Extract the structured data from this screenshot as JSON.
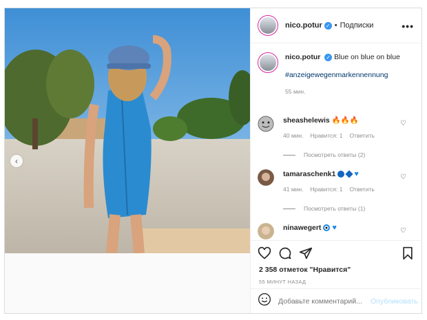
{
  "post": {
    "username": "nico.potur",
    "verified_mark": "✓",
    "separator": "•",
    "follow_label": "Подписки",
    "more_label": "•••",
    "carousel_prev": "‹"
  },
  "caption": {
    "username": "nico.potur",
    "text": "Blue on blue on blue",
    "hashtag": "#anzeigewegenmarkennennung",
    "time": "55 мин."
  },
  "comments": [
    {
      "username": "sheashelewis",
      "text": "🔥🔥🔥",
      "time": "40 мин.",
      "likes": "Нравится: 1",
      "reply": "Ответить",
      "replies": "Посмотреть ответы (2)"
    },
    {
      "username": "tamaraschenk1",
      "text": "",
      "time": "41 мин.",
      "likes": "Нравится: 1",
      "reply": "Ответить",
      "replies": "Посмотреть ответы (1)"
    },
    {
      "username": "ninawegert",
      "text": ""
    }
  ],
  "actions": {
    "likes_text": "2 358 отметок \"Нравится\"",
    "posted": "55 МИНУТ НАЗАД"
  },
  "add_comment": {
    "placeholder": "Добавьте комментарий...",
    "publish": "Опубликовать"
  },
  "icons": {
    "like": "heart-icon",
    "comment": "comment-icon",
    "share": "share-icon",
    "save": "bookmark-icon",
    "emoji": "emoji-icon"
  },
  "colors": {
    "link": "#00376b",
    "verified": "#3897f0",
    "publish_disabled": "#b2dffc"
  }
}
